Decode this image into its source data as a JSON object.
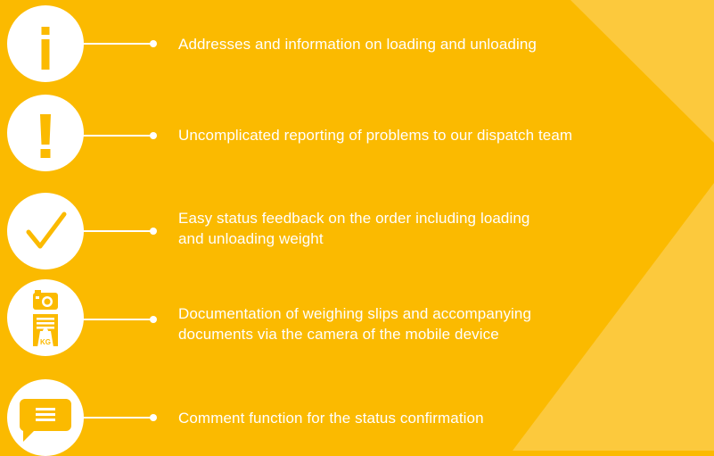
{
  "colors": {
    "background": "#fbba00",
    "stripe": "#fccd52",
    "icon_fill": "#ffffff",
    "icon_glyph": "#fbba00"
  },
  "features": [
    {
      "icon": "info-icon",
      "text": "Addresses and information on loading and unloading"
    },
    {
      "icon": "exclamation-icon",
      "text": "Uncomplicated reporting of problems to our dispatch team"
    },
    {
      "icon": "checkmark-icon",
      "text_line1": "Easy status feedback on the order including loading",
      "text_line2": "and unloading weight"
    },
    {
      "icon": "camera-scale-icon",
      "badge": "KG",
      "text_line1": "Documentation of weighing slips and accompanying",
      "text_line2": "documents via the camera of the mobile device"
    },
    {
      "icon": "comment-icon",
      "text": "Comment function for the status confirmation"
    }
  ]
}
